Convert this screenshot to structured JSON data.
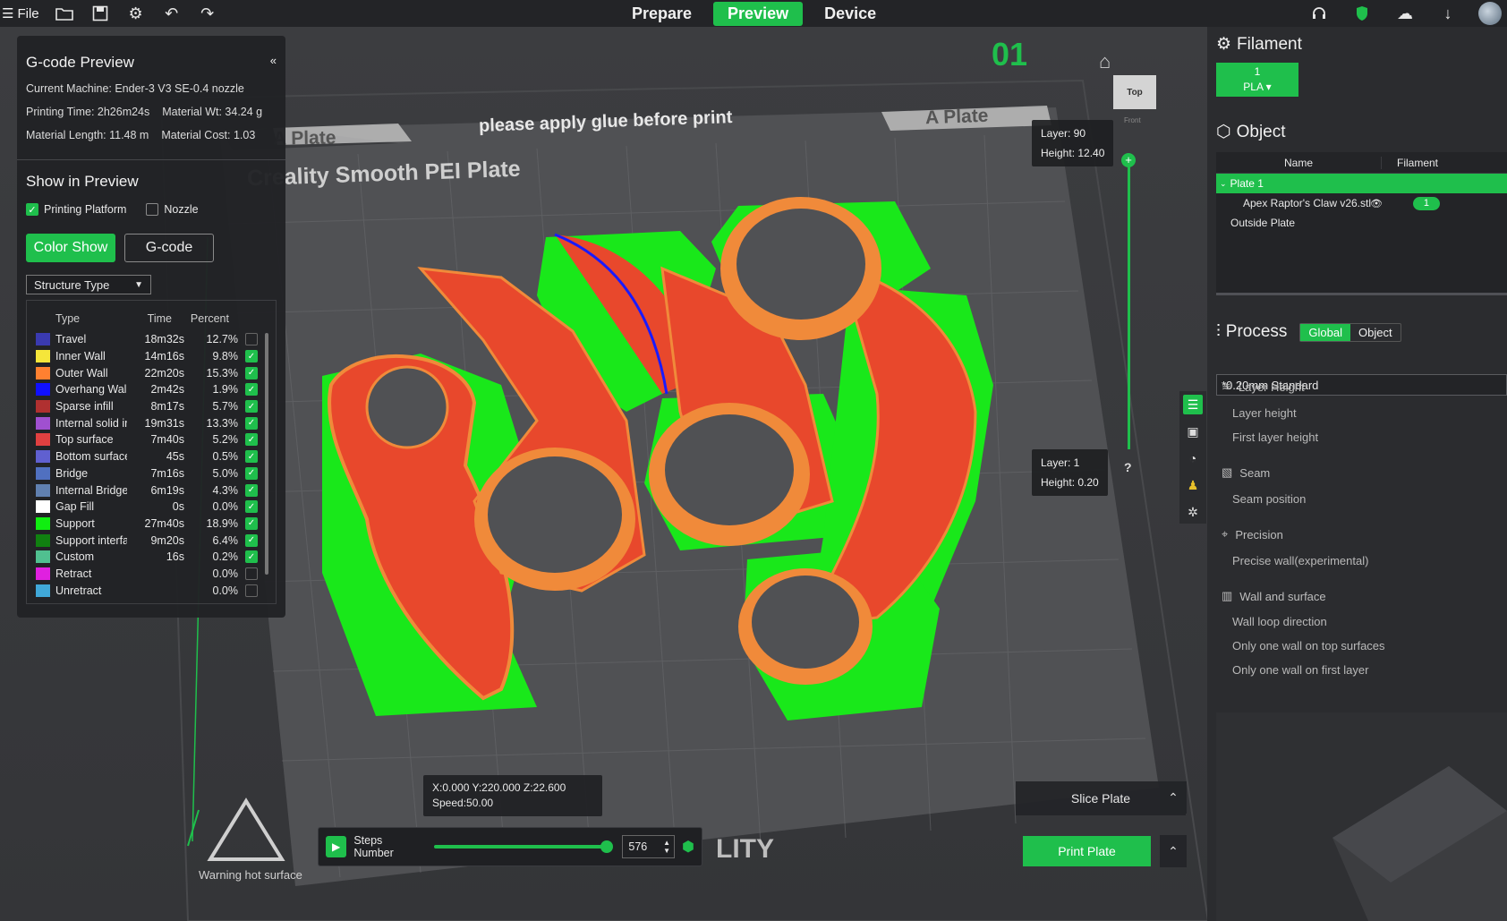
{
  "topbar": {
    "file_label": "File",
    "tabs": [
      "Prepare",
      "Preview",
      "Device"
    ],
    "active_tab": "Preview"
  },
  "gcode_panel": {
    "title": "G-code Preview",
    "collapse": "«",
    "machine": "Current Machine: Ender-3 V3 SE-0.4 nozzle",
    "printing_time": "Printing Time: 2h26m24s",
    "material_wt": "Material Wt: 34.24 g",
    "material_length": "Material Length: 11.48 m",
    "material_cost": "Material Cost: 1.03",
    "show_title": "Show in Preview",
    "printing_platform": "Printing Platform",
    "nozzle": "Nozzle",
    "color_show": "Color Show",
    "gcode": "G-code",
    "structure_select": "Structure Type",
    "legend_headers": {
      "type": "Type",
      "time": "Time",
      "percent": "Percent"
    },
    "legend": [
      {
        "type": "Travel",
        "time": "18m32s",
        "percent": "12.7%",
        "color": "#3a3ab0",
        "on": false
      },
      {
        "type": "Inner Wall",
        "time": "14m16s",
        "percent": "9.8%",
        "color": "#f5e63a",
        "on": true
      },
      {
        "type": "Outer Wall",
        "time": "22m20s",
        "percent": "15.3%",
        "color": "#ff8030",
        "on": true
      },
      {
        "type": "Overhang Wall",
        "time": "2m42s",
        "percent": "1.9%",
        "color": "#1010ff",
        "on": true
      },
      {
        "type": "Sparse infill",
        "time": "8m17s",
        "percent": "5.7%",
        "color": "#b03030",
        "on": true
      },
      {
        "type": "Internal solid infill",
        "time": "19m31s",
        "percent": "13.3%",
        "color": "#a050d0",
        "on": true
      },
      {
        "type": "Top surface",
        "time": "7m40s",
        "percent": "5.2%",
        "color": "#e04040",
        "on": true
      },
      {
        "type": "Bottom surface",
        "time": "45s",
        "percent": "0.5%",
        "color": "#6060d0",
        "on": true
      },
      {
        "type": "Bridge",
        "time": "7m16s",
        "percent": "5.0%",
        "color": "#5070c0",
        "on": true
      },
      {
        "type": "Internal Bridge",
        "time": "6m19s",
        "percent": "4.3%",
        "color": "#6080b0",
        "on": true
      },
      {
        "type": "Gap Fill",
        "time": "0s",
        "percent": "0.0%",
        "color": "#ffffff",
        "on": true
      },
      {
        "type": "Support",
        "time": "27m40s",
        "percent": "18.9%",
        "color": "#10ee10",
        "on": true
      },
      {
        "type": "Support interface",
        "time": "9m20s",
        "percent": "6.4%",
        "color": "#108010",
        "on": true
      },
      {
        "type": "Custom",
        "time": "16s",
        "percent": "0.2%",
        "color": "#50c090",
        "on": true
      },
      {
        "type": "Retract",
        "time": "",
        "percent": "0.0%",
        "color": "#e020e0",
        "on": false
      },
      {
        "type": "Unretract",
        "time": "",
        "percent": "0.0%",
        "color": "#40a8d8",
        "on": false
      }
    ]
  },
  "viewport": {
    "plate_number": "01",
    "plate_label_left": "A Plate",
    "plate_label_right": "A Plate",
    "glue_notice": "please apply glue before print",
    "plate_name": "Creality Smooth PEI Plate",
    "logo_fragment": "LITY",
    "warning": "Warning hot surface",
    "view_top": "Top",
    "view_front": "Front",
    "layer_top": "Layer: 90",
    "height_top": "Height: 12.40",
    "layer_bottom": "Layer: 1",
    "height_bottom": "Height: 0.20",
    "help": "?",
    "coords": "X:0.000  Y:220.000  Z:22.600",
    "speed": "Speed:50.00",
    "steps_label": "Steps Number",
    "steps_value": "576",
    "slice_plate": "Slice Plate",
    "print_plate": "Print Plate"
  },
  "right_panel": {
    "filament_title": "Filament",
    "filament_slot": "1",
    "filament_type": "PLA",
    "object_title": "Object",
    "col_name": "Name",
    "col_filament": "Filament",
    "plate_row": "Plate 1",
    "object_row": "Apex Raptor's Claw v26.stl",
    "object_filament": "1",
    "outside_row": "Outside Plate",
    "process_title": "Process",
    "seg_global": "Global",
    "seg_object": "Object",
    "preset": "*0.20mm Standard",
    "groups": [
      {
        "title": "Layer Height",
        "items": [
          "Layer height",
          "First layer height"
        ]
      },
      {
        "title": "Seam",
        "items": [
          "Seam position"
        ]
      },
      {
        "title": "Precision",
        "items": [
          "Precise wall(experimental)"
        ]
      },
      {
        "title": "Wall and surface",
        "items": [
          "Wall loop direction",
          "Only one wall on top surfaces",
          "Only one wall on first layer"
        ]
      }
    ]
  },
  "colors": {
    "accent": "#1fbf4c",
    "part": "#e8482c",
    "part_edge": "#f08a3a",
    "support": "#19e81a",
    "bed": "#5a5b5e"
  }
}
